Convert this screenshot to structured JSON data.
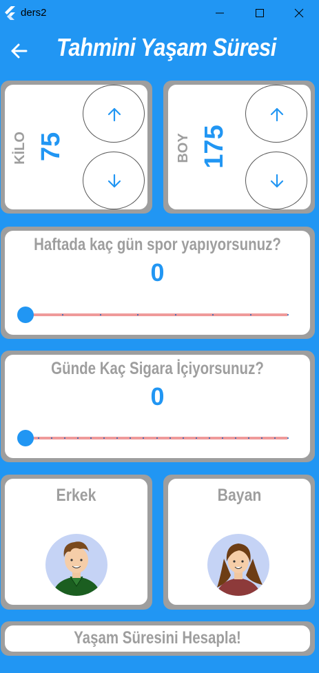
{
  "window": {
    "title": "ders2",
    "minimize_icon": "minimize-icon",
    "maximize_icon": "maximize-icon",
    "close_icon": "close-icon"
  },
  "appbar": {
    "title": "Tahmini Yaşam Süresi",
    "back_icon": "arrow-left-icon"
  },
  "weight": {
    "label": "KİLO",
    "value": "75"
  },
  "height": {
    "label": "BOY",
    "value": "175"
  },
  "sport": {
    "question": "Haftada kaç gün spor yapıyorsunuz?",
    "value": "0",
    "slider_value": 0,
    "slider_max": 7
  },
  "smoke": {
    "question": "Günde Kaç Sigara İçiyorsunuz?",
    "value": "0",
    "slider_value": 0,
    "slider_max": 20
  },
  "gender": {
    "male": "Erkek",
    "female": "Bayan"
  },
  "calculate": {
    "label": "Yaşam Süresini Hesapla!"
  },
  "colors": {
    "accent": "#2196F3",
    "track": "#ef9a9a",
    "muted": "#9e9e9e"
  }
}
